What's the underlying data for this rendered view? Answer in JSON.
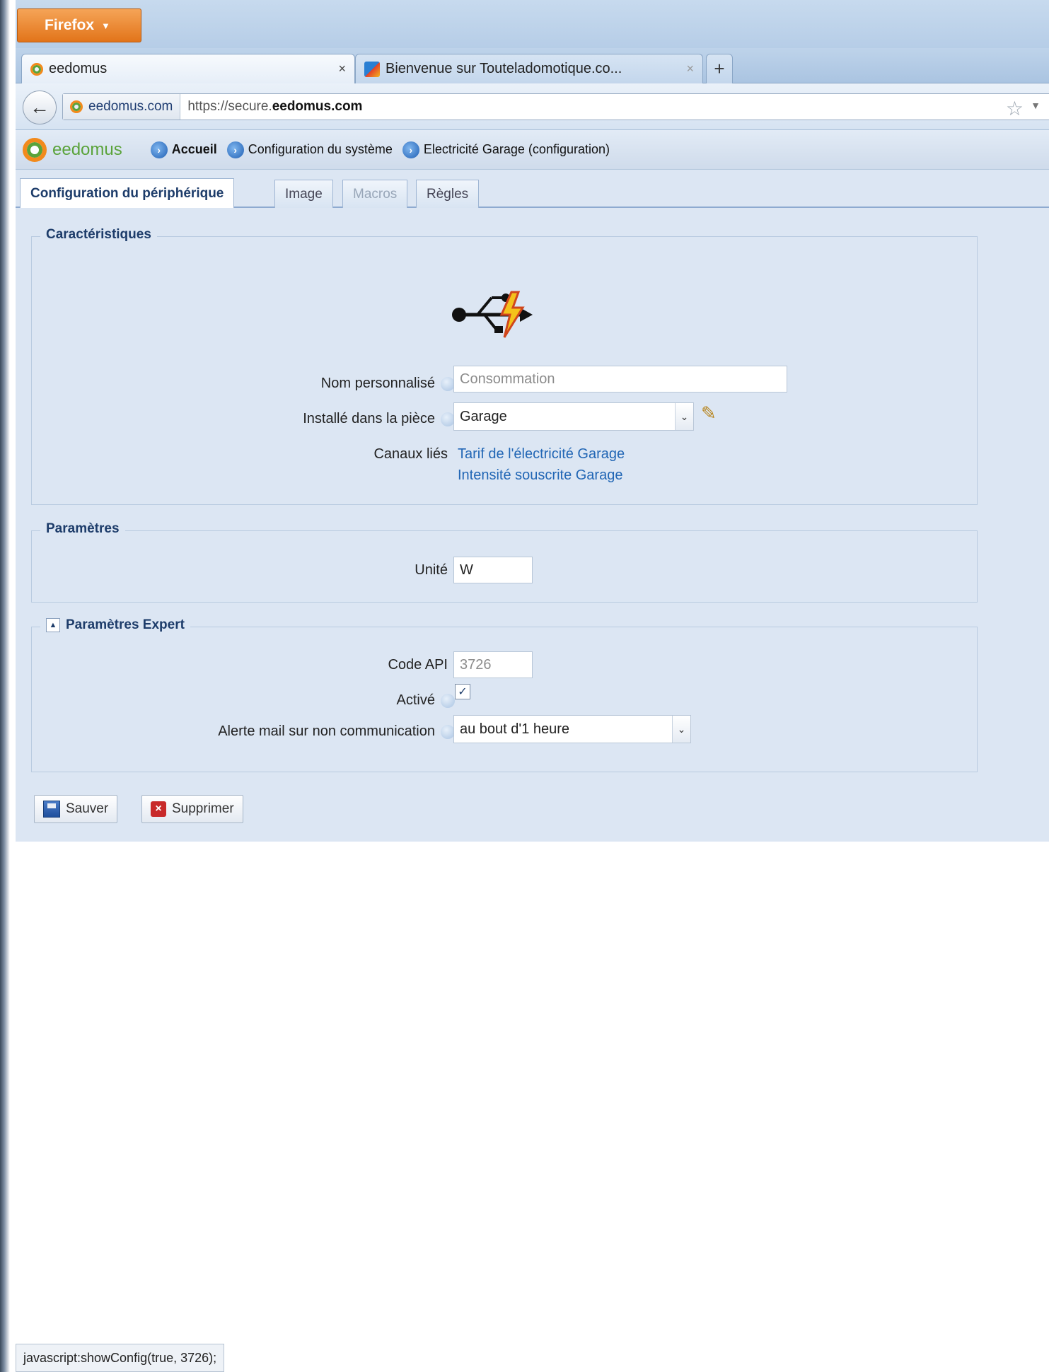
{
  "browser": {
    "menu_button": "Firefox",
    "tabs": [
      {
        "label": "eedomus",
        "close": "×"
      },
      {
        "label": "Bienvenue sur Touteladomotique.co...",
        "close": "×"
      }
    ],
    "new_tab": "+",
    "identity": "eedomus.com",
    "url_prefix": "https://secure.",
    "url_host": "eedomus.com",
    "status_text": "javascript:showConfig(true, 3726);"
  },
  "app": {
    "logo_text": "eedomus",
    "breadcrumb": [
      {
        "label": "Accueil"
      },
      {
        "label": "Configuration du système"
      },
      {
        "label": "Electricité Garage (configuration)"
      }
    ],
    "page_tabs": [
      {
        "label": "Configuration du périphérique",
        "state": "active"
      },
      {
        "label": "Image",
        "state": "normal"
      },
      {
        "label": "Macros",
        "state": "disabled"
      },
      {
        "label": "Règles",
        "state": "normal"
      }
    ]
  },
  "caracteristiques": {
    "legend": "Caractéristiques",
    "device_icon": "usb-power-icon",
    "name_label": "Nom personnalisé",
    "name_placeholder": "Consommation",
    "room_label": "Installé dans la pièce",
    "room_value": "Garage",
    "channels_label": "Canaux liés",
    "channels": [
      "Tarif de l'électricité Garage",
      "Intensité souscrite Garage"
    ]
  },
  "parametres": {
    "legend": "Paramètres",
    "unit_label": "Unité",
    "unit_value": "W"
  },
  "expert": {
    "legend": "Paramètres Expert",
    "collapse_glyph": "▲",
    "api_label": "Code API",
    "api_value": "3726",
    "active_label": "Activé",
    "active_checked": true,
    "alert_label": "Alerte mail sur non communication",
    "alert_value": "au bout d'1 heure"
  },
  "actions": {
    "save_label": "Sauver",
    "delete_label": "Supprimer"
  },
  "colors": {
    "accent": "#1d3c6a",
    "link": "#2166b5",
    "panel": "#dce6f3",
    "firefox_orange": "#e2741a"
  }
}
